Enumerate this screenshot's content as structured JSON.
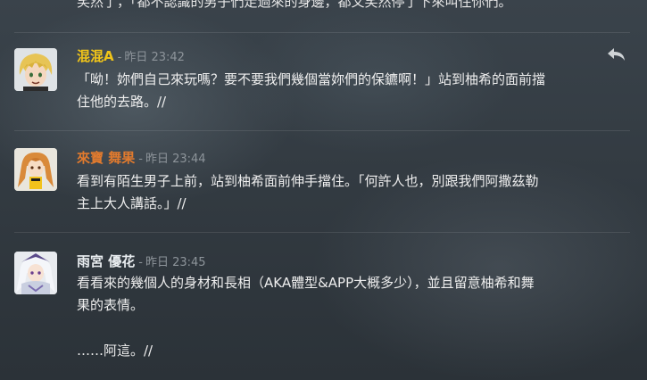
{
  "top_message": {
    "text": "笑然了，「都不認識的男子們走過來的身邊，都又笑然停了下來叫住你們。"
  },
  "messages": [
    {
      "username": "混混A",
      "username_color": "#f0c419",
      "separator": "-",
      "timestamp": "昨日 23:42",
      "line1": "「呦！妳們自己來玩嗎？要不要我們幾個當妳們的保鑣啊！」站到柚希的面前擋",
      "line2": "住他的去路。//",
      "avatar_icon": "anime-avatar-blonde"
    },
    {
      "username": "來寶 舞果",
      "username_color": "#e07a2e",
      "separator": "-",
      "timestamp": "昨日 23:44",
      "line1": "看到有陌生男子上前，站到柚希面前伸手擋住。「何許人也，別跟我們阿撒茲勒",
      "line2": "主上大人講話。」//",
      "avatar_icon": "anime-avatar-orange"
    },
    {
      "username": "雨宮 優花",
      "username_color": "#e9edf0",
      "separator": "-",
      "timestamp": "昨日 23:45",
      "line1": "看看來的幾個人的身材和長相（AKA體型&APP大概多少），並且留意柚希和舞",
      "line2": "果的表情。",
      "line3": "……阿這。//",
      "avatar_icon": "anime-avatar-white"
    }
  ],
  "reply_icon": "reply-arrow-icon"
}
